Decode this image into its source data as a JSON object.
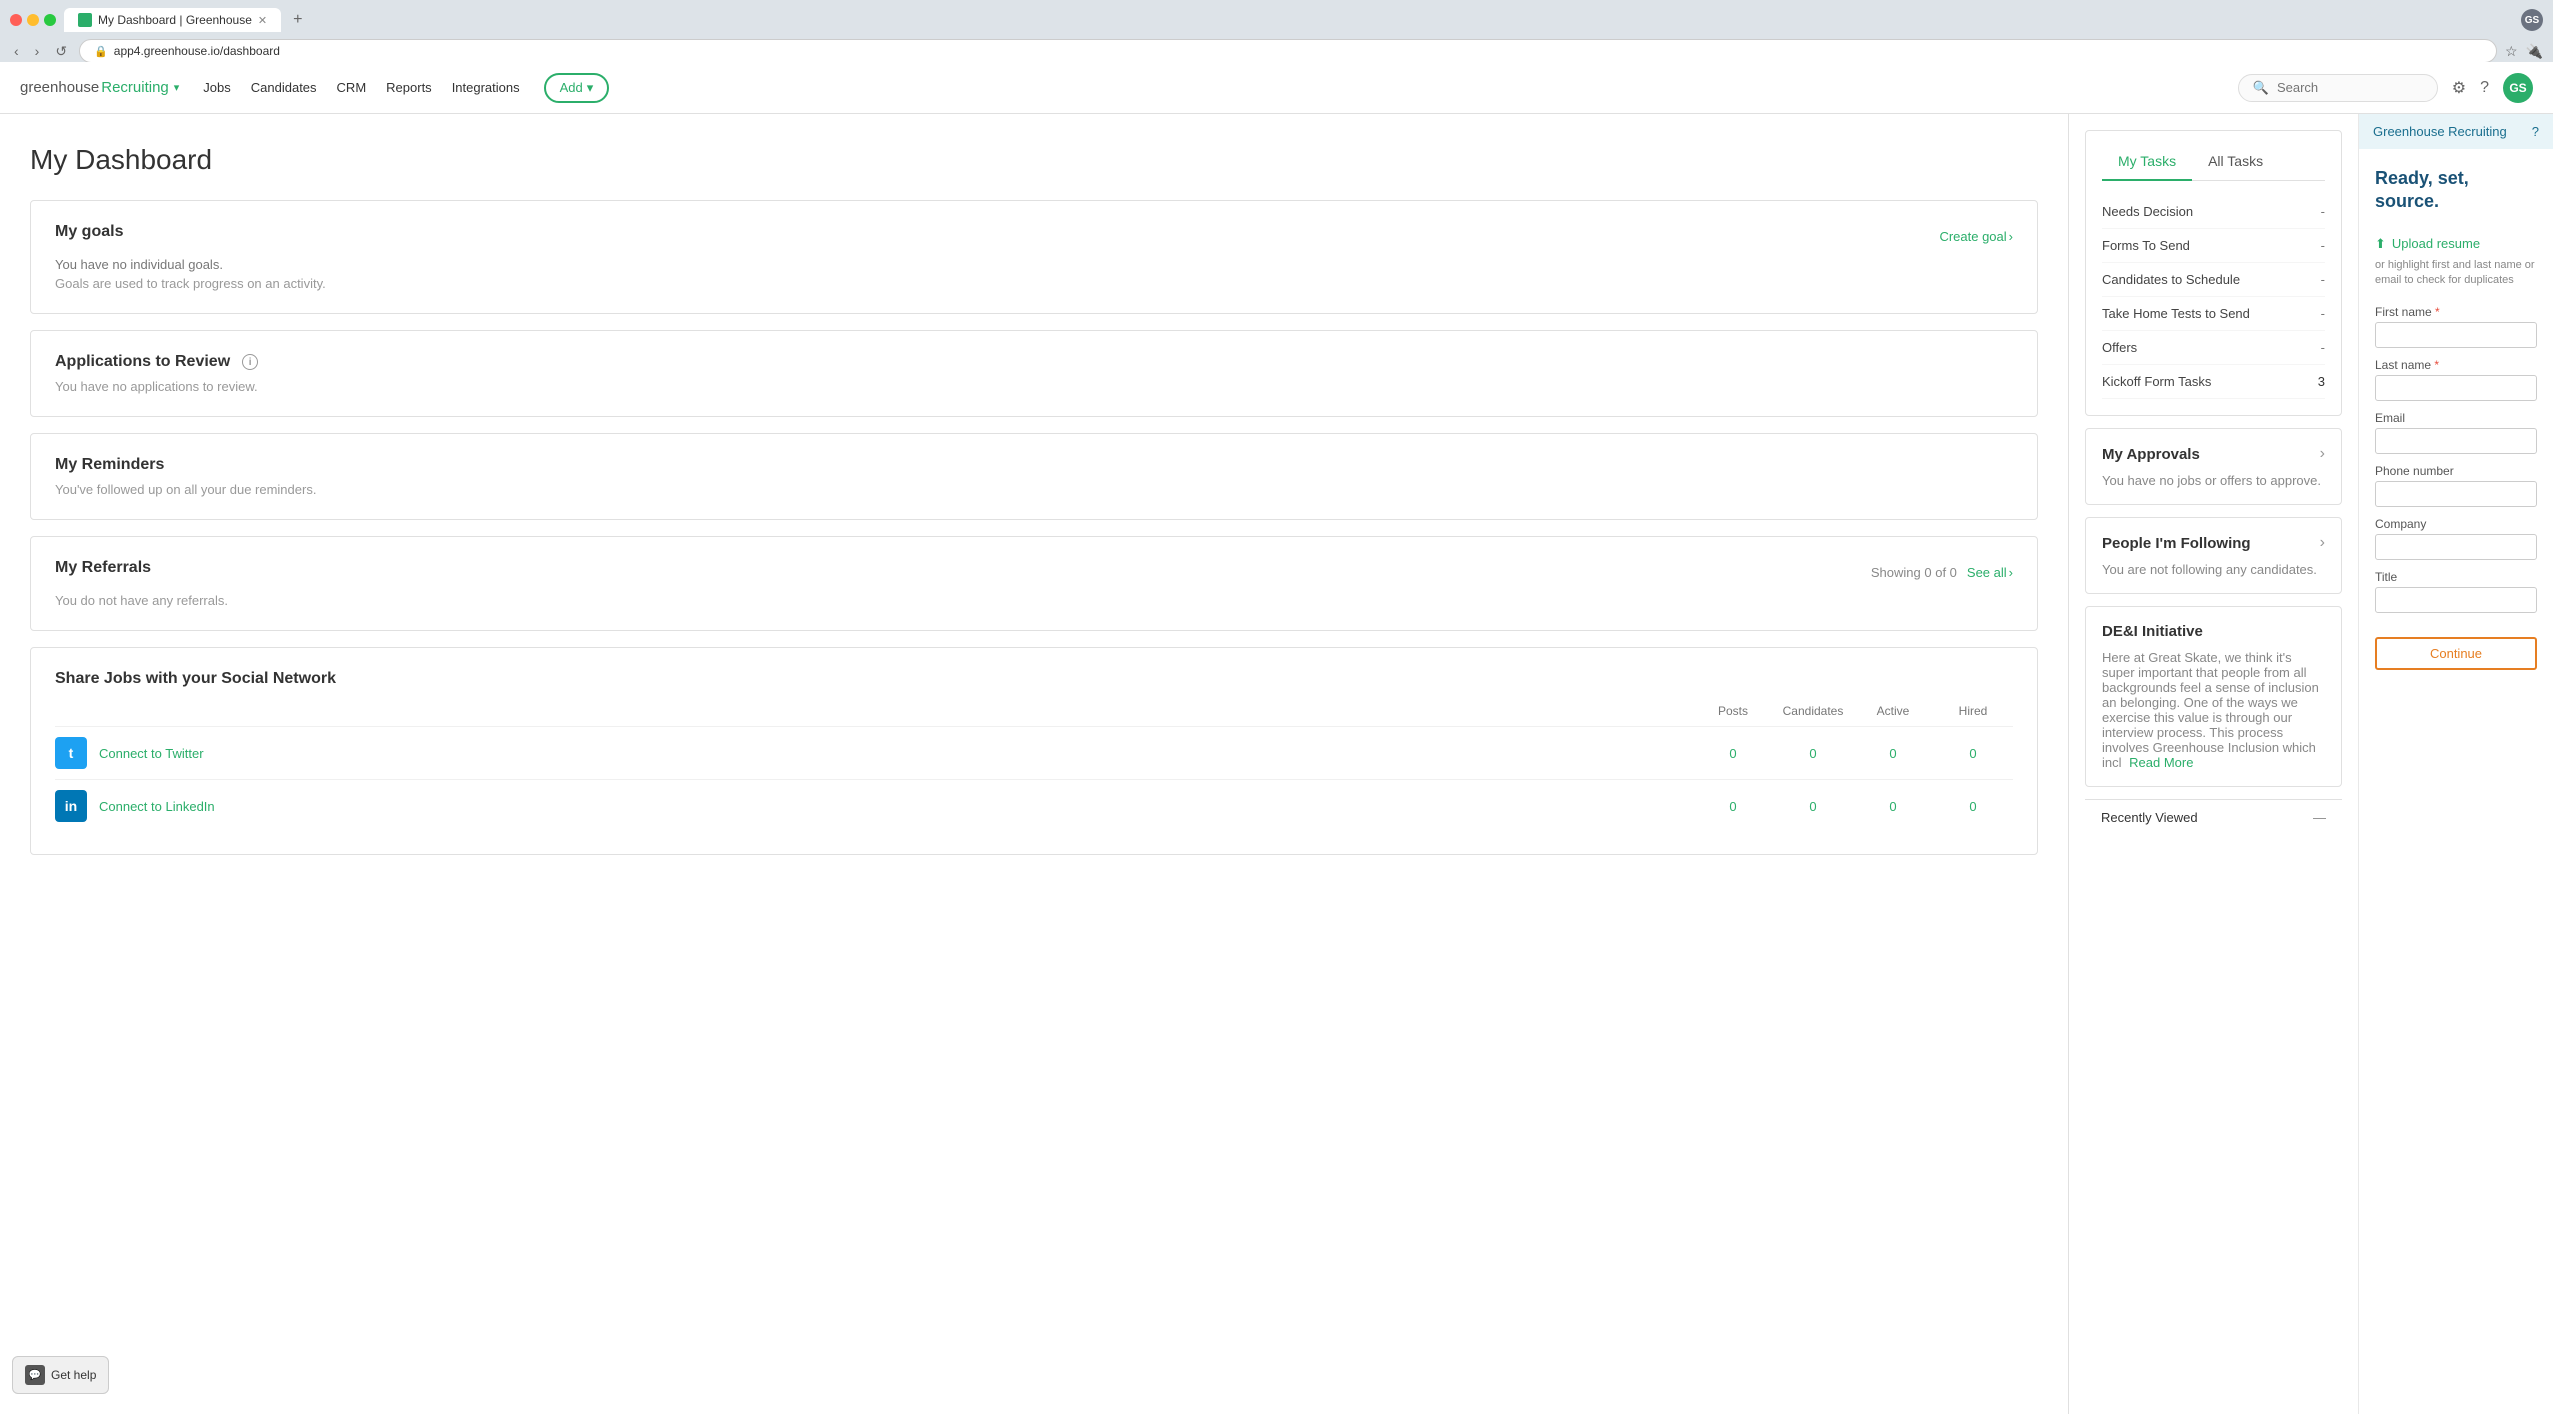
{
  "browser": {
    "tab_title": "My Dashboard | Greenhouse",
    "url": "app4.greenhouse.io/dashboard",
    "new_tab_btn": "+",
    "profile_initials": "GS"
  },
  "nav": {
    "logo_greenhouse": "greenhouse",
    "logo_recruiting": "Recruiting",
    "links": [
      "Jobs",
      "Candidates",
      "CRM",
      "Reports",
      "Integrations"
    ],
    "add_btn": "Add",
    "search_placeholder": "Search",
    "user_initials": "GS"
  },
  "page_title": "My Dashboard",
  "goals": {
    "title": "My goals",
    "create_goal": "Create goal",
    "subtitle": "You have no individual goals.",
    "desc": "Goals are used to track progress on an activity."
  },
  "applications": {
    "title": "Applications to Review",
    "desc": "You have no applications to review."
  },
  "reminders": {
    "title": "My Reminders",
    "desc": "You've followed up on all your due reminders."
  },
  "referrals": {
    "title": "My Referrals",
    "showing": "Showing 0 of 0",
    "see_all": "See all",
    "desc": "You do not have any referrals."
  },
  "social": {
    "title": "Share Jobs with your Social Network",
    "columns": [
      "Posts",
      "Candidates",
      "Active",
      "Hired"
    ],
    "rows": [
      {
        "platform": "Twitter",
        "link": "Connect to Twitter",
        "posts": "0",
        "candidates": "0",
        "active": "0",
        "hired": "0"
      },
      {
        "platform": "LinkedIn",
        "link": "Connect to LinkedIn",
        "posts": "0",
        "candidates": "0",
        "active": "0",
        "hired": "0"
      }
    ]
  },
  "tasks": {
    "tab_my": "My Tasks",
    "tab_all": "All Tasks",
    "items": [
      {
        "label": "Needs Decision",
        "value": "-"
      },
      {
        "label": "Forms To Send",
        "value": "-"
      },
      {
        "label": "Candidates to Schedule",
        "value": "-"
      },
      {
        "label": "Take Home Tests to Send",
        "value": "-"
      },
      {
        "label": "Offers",
        "value": "-"
      },
      {
        "label": "Kickoff Form Tasks",
        "value": "3",
        "is_count": true
      }
    ]
  },
  "approvals": {
    "title": "My Approvals",
    "desc": "You have no jobs or offers to approve."
  },
  "following": {
    "title": "People I'm Following",
    "desc": "You are not following any candidates."
  },
  "dei": {
    "title": "DE&I Initiative",
    "body": "Here at Great Skate, we think it's super important that people from all backgrounds feel a sense of inclusion an belonging. One of the ways we exercise this value is through our interview process. This process involves Greenhouse Inclusion which incl",
    "read_more": "Read More"
  },
  "right_panel": {
    "header_app": "Greenhouse Recruiting",
    "question_icon": "?",
    "tagline": "Ready, set, source.",
    "upload_link": "Upload resume",
    "upload_desc": "or highlight first and last name or email to check for duplicates",
    "fields": [
      {
        "label": "First name",
        "required": true,
        "name": "first_name_field"
      },
      {
        "label": "Last name",
        "required": true,
        "name": "last_name_field"
      },
      {
        "label": "Email",
        "required": false,
        "name": "email_field"
      },
      {
        "label": "Phone number",
        "required": false,
        "name": "phone_field"
      },
      {
        "label": "Company",
        "required": false,
        "name": "company_field"
      },
      {
        "label": "Title",
        "required": false,
        "name": "title_field"
      }
    ],
    "continue_btn": "Continue"
  },
  "recently_viewed": {
    "label": "Recently Viewed",
    "close": "—"
  },
  "help": {
    "label": "Get help",
    "icon": "💬"
  }
}
